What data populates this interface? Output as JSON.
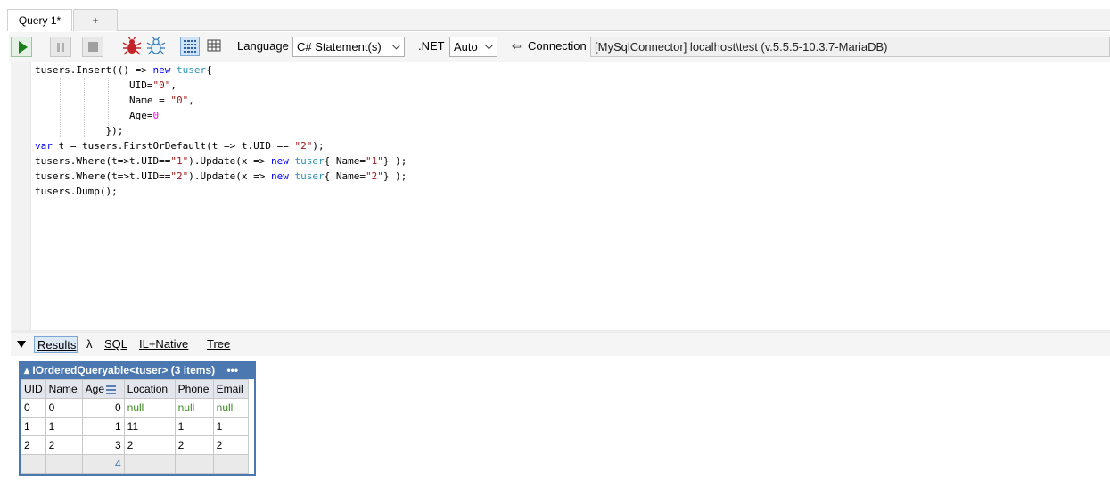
{
  "tabs": [
    {
      "label": "Query 1*"
    },
    {
      "label": "+"
    }
  ],
  "toolbar": {
    "language_label": "Language",
    "language_value": "C# Statement(s)",
    "net_label": ".NET",
    "net_value": "Auto",
    "connection_arrow": "⇦",
    "connection_label": "Connection",
    "connection_value": "[MySqlConnector] localhost\\test (v.5.5.5-10.3.7-MariaDB)"
  },
  "code_lines": [
    "tusers.Insert(() => new tuser{",
    "                UID=\"0\",",
    "                Name = \"0\",",
    "                Age=0",
    "            });",
    "var t = tusers.FirstOrDefault(t => t.UID == \"2\");",
    "tusers.Where(t=>t.UID==\"1\").Update(x => new tuser{ Name=\"1\"} );",
    "tusers.Where(t=>t.UID==\"2\").Update(x => new tuser{ Name=\"2\"} );",
    "tusers.Dump();"
  ],
  "result_tabs": [
    {
      "label": "Results"
    },
    {
      "label": "λ"
    },
    {
      "label": "SQL"
    },
    {
      "label": "IL+Native"
    },
    {
      "label": "Tree"
    }
  ],
  "grid": {
    "title": "▴ IOrderedQueryable<tuser> (3 items)",
    "more": "•••",
    "columns": [
      "UID",
      "Name",
      "Age",
      "Location",
      "Phone",
      "Email"
    ],
    "rows": [
      [
        "0",
        "0",
        "0",
        "null",
        "null",
        "null"
      ],
      [
        "1",
        "1",
        "1",
        "11",
        "1",
        "1"
      ],
      [
        "2",
        "2",
        "3",
        "2",
        "2",
        "2"
      ]
    ],
    "total": [
      "",
      "",
      "4",
      "",
      "",
      ""
    ]
  }
}
